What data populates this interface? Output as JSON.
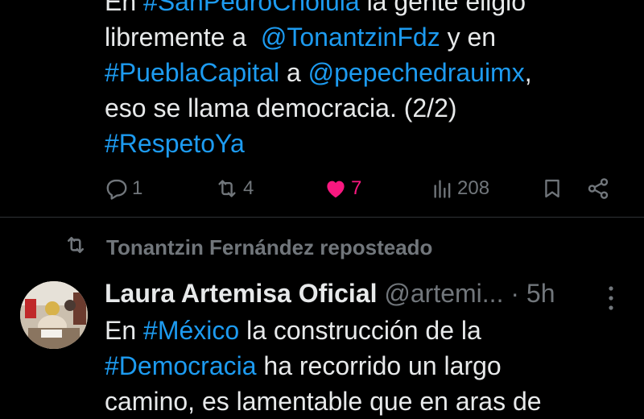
{
  "tweet1": {
    "line0_prefix": "En ",
    "line0_hashtag": "#SanPedroCholula",
    "line0_suffix": " la gente eligió",
    "line1_prefix": "libremente a  ",
    "line1_mention": "@TonantzinFdz",
    "line1_suffix": " y en",
    "line2_hashtag": "#PueblaCapital",
    "line2_mid": " a ",
    "line2_mention": "@pepechedrauimx",
    "line2_suffix": ",",
    "line3": "eso se llama democracia. (2/2)",
    "line4_hashtag": "#RespetoYa",
    "actions": {
      "replies": "1",
      "reposts": "4",
      "likes": "7",
      "views": "208"
    }
  },
  "repost_banner": "Tonantzin Fernández reposteado",
  "tweet2": {
    "name": "Laura Artemisa Oficial",
    "handle": "@artemi...",
    "time": " · 5h",
    "line0_prefix": "En ",
    "line0_hashtag": "#México",
    "line0_suffix": " la construcción de la",
    "line1_hashtag": "#Democracia",
    "line1_suffix": " ha recorrido un largo",
    "line2": "camino, es lamentable que en aras de"
  },
  "colors": {
    "link": "#1d9bf0",
    "like": "#f91880",
    "muted": "#71767b",
    "text": "#e7e9ea",
    "background": "#000000"
  },
  "icons": [
    "reply-icon",
    "repost-icon",
    "heart-icon",
    "views-icon",
    "bookmark-icon",
    "share-icon",
    "more-icon"
  ]
}
